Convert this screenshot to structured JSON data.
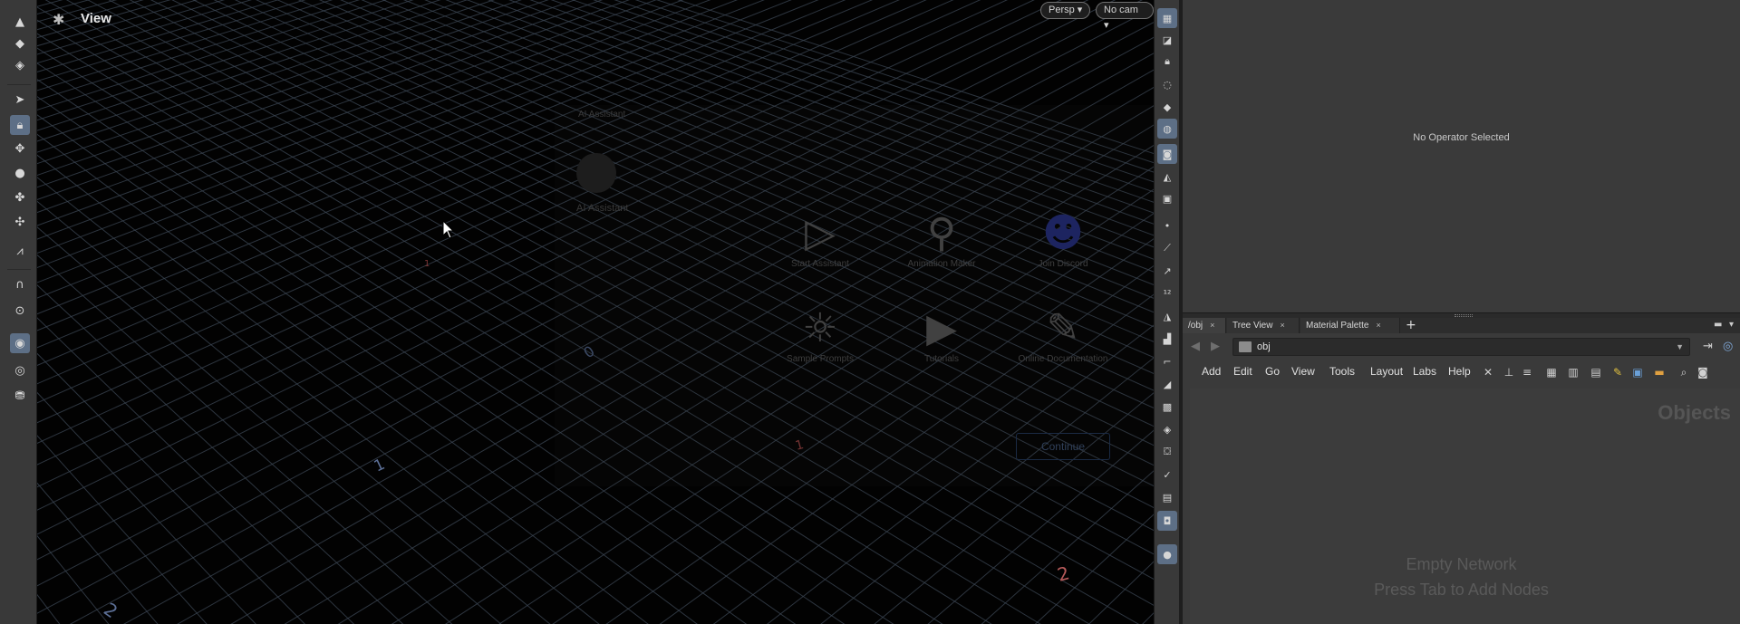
{
  "viewport": {
    "title": "View",
    "persp_label": "Persp",
    "cam_label": "No cam",
    "grid_labels": [
      "1",
      "2",
      "2",
      "1",
      "1",
      "0"
    ]
  },
  "dialog": {
    "title": "AI Assistant",
    "app_name": "AI Assistant",
    "tiles": [
      {
        "label": "Start Assistant",
        "icon": "play-icon"
      },
      {
        "label": "Animation Maker",
        "icon": "figure-icon"
      },
      {
        "label": "Join Discord",
        "icon": "discord-icon"
      },
      {
        "label": "Sample Prompts",
        "icon": "lightbulb-icon"
      },
      {
        "label": "Tutorials",
        "icon": "youtube-icon"
      },
      {
        "label": "Online Documentation",
        "icon": "document-icon"
      }
    ],
    "continue_label": "Continue"
  },
  "param_pane": {
    "message": "No Operator Selected"
  },
  "network": {
    "tabs": [
      {
        "label": "/obj"
      },
      {
        "label": "Tree View"
      },
      {
        "label": "Material Palette"
      }
    ],
    "path": "obj",
    "menus": [
      "Add",
      "Edit",
      "Go",
      "View",
      "Tools",
      "Layout",
      "Labs",
      "Help"
    ],
    "context_label": "Objects",
    "empty_line1": "Empty Network",
    "empty_line2": "Press Tab to Add Nodes"
  },
  "colors": {
    "accent": "#5d6f86",
    "grid": "#3c4754",
    "background": "#020202"
  }
}
